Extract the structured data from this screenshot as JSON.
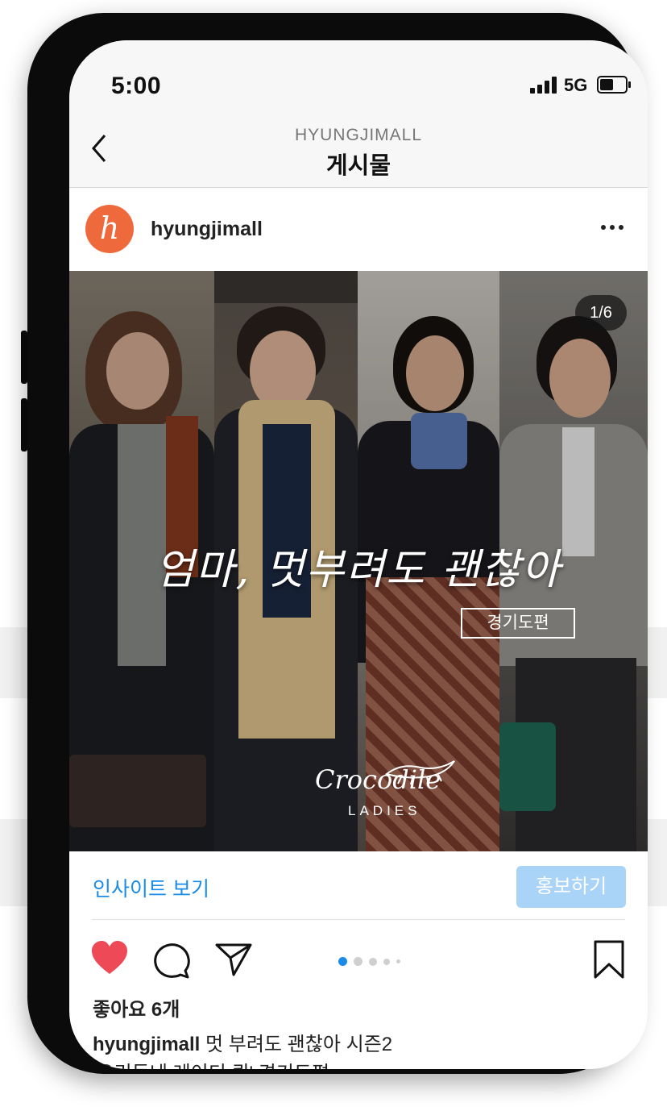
{
  "status": {
    "time": "5:00",
    "network": "5G"
  },
  "header": {
    "account": "HYUNGJIMALL",
    "title": "게시물"
  },
  "post": {
    "avatar_letter": "h",
    "username": "hyungjimall",
    "counter": "1/6",
    "headline": "엄마, 멋부려도 괜찮아",
    "edition": "경기도편",
    "brand": "Crocodile",
    "brand_sub": "LADIES",
    "insights": "인사이트 보기",
    "promote": "홍보하기",
    "likes": "좋아요 6개",
    "caption_user": "hyungjimall",
    "caption_text": " 멋 부려도 괜찮아 시즌2",
    "caption_line2": "'우리동네 레이디 퀸' 경기도편"
  },
  "colors": {
    "accent": "#1a8ce8",
    "heart": "#ed4956",
    "avatar": "#ee6a3c",
    "promote": "#a9d4f7"
  },
  "icons": [
    "back-chevron-icon",
    "more-icon",
    "heart-icon",
    "comment-icon",
    "share-icon",
    "bookmark-icon"
  ]
}
